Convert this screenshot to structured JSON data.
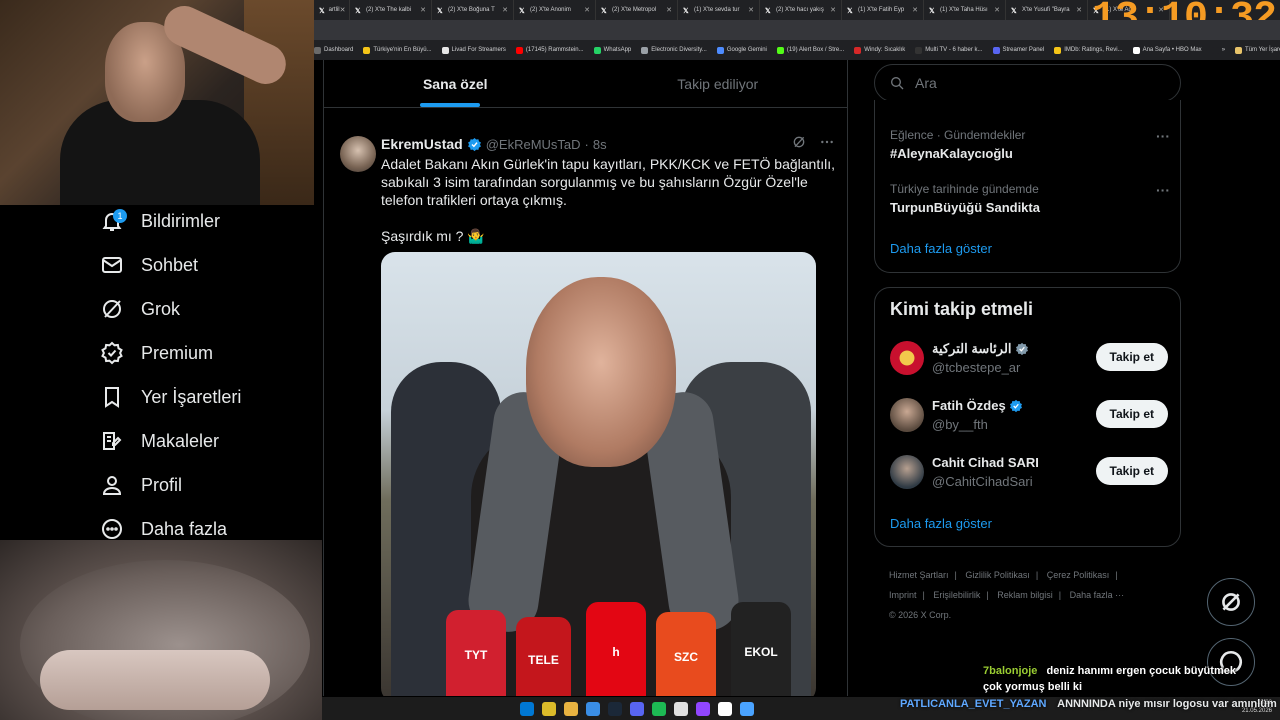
{
  "clock": "13:10:32",
  "browser": {
    "tabs": [
      {
        "label": "artlil",
        "icon": "x-icon"
      },
      {
        "label": "(2) X'te The kalbi",
        "icon": "x-icon"
      },
      {
        "label": "(2) X'te Boğuna T",
        "icon": "x-icon"
      },
      {
        "label": "(2) X'te Anonim",
        "icon": "x-icon"
      },
      {
        "label": "(2) X'te Metropol",
        "icon": "x-icon"
      },
      {
        "label": "(1) X'te sevda tur",
        "icon": "x-icon"
      },
      {
        "label": "(2) X'te hacı yakış",
        "icon": "x-icon"
      },
      {
        "label": "(1) X'te Fatih Eyp",
        "icon": "x-icon"
      },
      {
        "label": "(1) X'te Taha Hüsı",
        "icon": "x-icon"
      },
      {
        "label": "X'te Yusufi \"Bayra",
        "icon": "x-icon"
      },
      {
        "label": "(1) X'te Ag",
        "icon": "x-icon"
      }
    ],
    "bookmarks": [
      {
        "label": "Dashboard",
        "color": "#6a6a6a"
      },
      {
        "label": "Türkiye'nin En Büyü...",
        "color": "#f5c518"
      },
      {
        "label": "Livad For Streamers",
        "color": "#e6e6e6"
      },
      {
        "label": "(17145) Rammstein...",
        "color": "#ff0000"
      },
      {
        "label": "WhatsApp",
        "color": "#25d366"
      },
      {
        "label": "Electronic Diversity...",
        "color": "#9aa0a6"
      },
      {
        "label": "Google Gemini",
        "color": "#4e8cff"
      },
      {
        "label": "(19) Alert Box / Stre...",
        "color": "#53fc18"
      },
      {
        "label": "Windy: Sıcaklık",
        "color": "#d62828"
      },
      {
        "label": "Multi TV - 6 haber k...",
        "color": "#333333"
      },
      {
        "label": "Streamer Panel",
        "color": "#5865f2"
      },
      {
        "label": "IMDb: Ratings, Revi...",
        "color": "#f5c518"
      },
      {
        "label": "Ana Sayfa • HBO Max",
        "color": "#ffffff"
      },
      {
        "label": "»",
        "color": "#202124"
      },
      {
        "label": "Tüm Yer İşaretleri",
        "color": "#e8c46a"
      }
    ]
  },
  "nav": {
    "items": [
      {
        "label": "Bildirimler",
        "icon": "bell-icon",
        "badge": "1"
      },
      {
        "label": "Sohbet",
        "icon": "mail-icon"
      },
      {
        "label": "Grok",
        "icon": "grok-icon"
      },
      {
        "label": "Premium",
        "icon": "verified-badge-icon"
      },
      {
        "label": "Yer İşaretleri",
        "icon": "bookmark-icon"
      },
      {
        "label": "Makaleler",
        "icon": "article-icon"
      },
      {
        "label": "Profil",
        "icon": "person-icon"
      },
      {
        "label": "Daha fazla",
        "icon": "more-circle-icon"
      }
    ]
  },
  "timeline": {
    "tabs": [
      {
        "label": "Sana özel",
        "active": true
      },
      {
        "label": "Takip ediliyor",
        "active": false
      }
    ],
    "tweet": {
      "name": "EkremUstad",
      "handle": "@EkReMUsTaD",
      "dot": "·",
      "time": "8s",
      "text_lines": [
        "Adalet Bakanı Akın Gürlek'in tapu kayıtları, PKK/KCK ve FETÖ bağlantılı, sabıkalı 3 isim tarafından sorgulanmış ve bu şahısların Özgür Özel'le telefon trafikleri ortaya çıkmış.",
        "Şaşırdık mı ? 🤷‍♂️"
      ],
      "media": {
        "mics": [
          {
            "label": "TYT",
            "color": "#d1202f"
          },
          {
            "label": "TELE",
            "color": "#c4161c"
          },
          {
            "label": "h",
            "color": "#e30613"
          },
          {
            "label": "SZC",
            "color": "#e84b1e"
          },
          {
            "label": "EKOL",
            "color": "#222222"
          }
        ]
      }
    }
  },
  "sidebar": {
    "search_placeholder": "Ara",
    "trends": [
      {
        "meta": "Eğlence · Gündemdekiler",
        "title": "#AleynaKalaycıoğlu"
      },
      {
        "meta": "Türkiye tarihinde gündemde",
        "title": "TurpunBüyüğü Sandikta"
      }
    ],
    "trends_more": "Daha fazla göster",
    "who_to_follow": {
      "title": "Kimi takip etmeli",
      "accounts": [
        {
          "name": "الرئاسة التركية",
          "handle": "@tcbestepe_ar",
          "button": "Takip et",
          "avatar_color": "#c8102e",
          "verified": "gray"
        },
        {
          "name": "Fatih Özdeş",
          "handle": "@by__fth",
          "button": "Takip et",
          "avatar_color": "#6e6258",
          "verified": "blue"
        },
        {
          "name": "Cahit Cihad SARI",
          "handle": "@CahitCihadSari",
          "button": "Takip et",
          "avatar_color": "#4a5660",
          "verified": "none"
        }
      ],
      "more": "Daha fazla göster"
    },
    "footer": {
      "line1": [
        "Hizmet Şartları",
        "Gizlilik Politikası",
        "Çerez Politikası"
      ],
      "line2": [
        "Imprint",
        "Erişilebilirlik",
        "Reklam bilgisi",
        "Daha fazla ···"
      ],
      "copyright": "© 2026 X Corp."
    }
  },
  "chat": {
    "messages": [
      {
        "user": "7balonjoje",
        "text": "deniz hanımı ergen çocuk büyütmek çok yormuş belli ki"
      }
    ],
    "ticker": {
      "user": "PATLICANLA_EVET_YAZAN",
      "text": "ANNNINDA niye mısır logosu var amınlüm"
    }
  },
  "tray": {
    "time": "13:33",
    "date": "21.05.2026"
  },
  "colors": {
    "accent": "#1d9bf0",
    "text": "#e7e9ea",
    "muted": "#71767b",
    "clock": "#f59b23"
  }
}
